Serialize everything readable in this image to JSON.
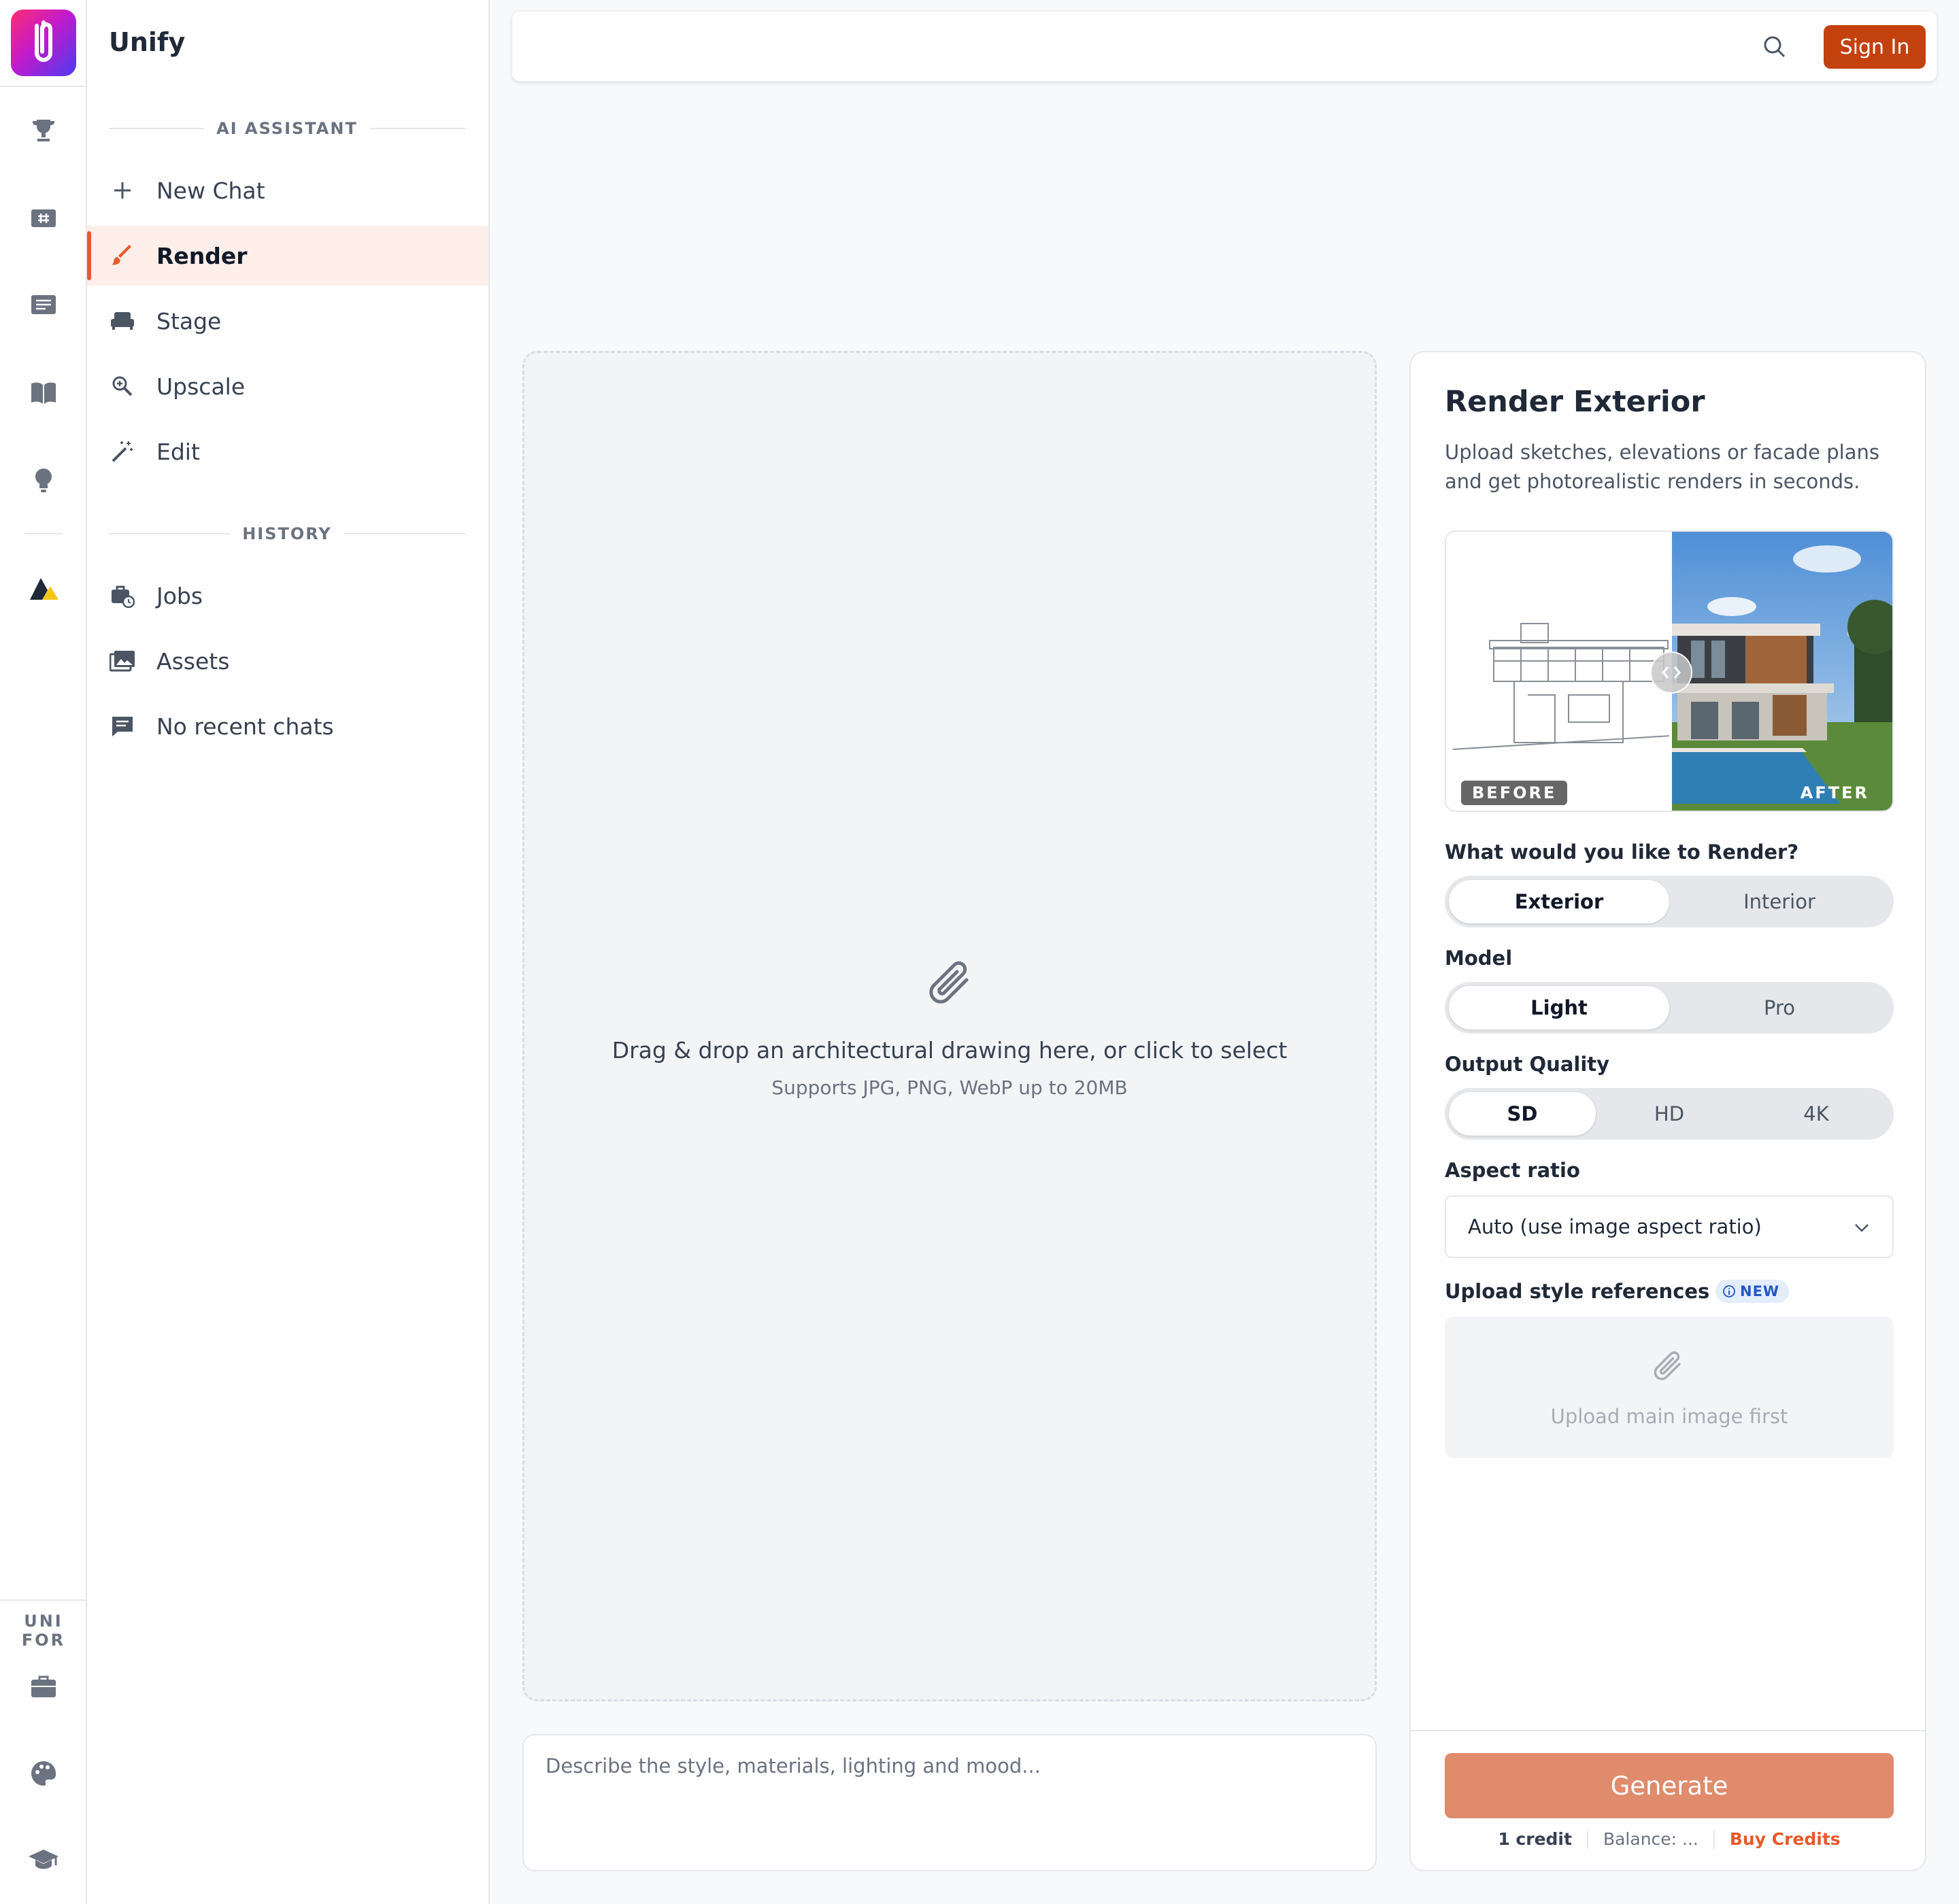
{
  "app": {
    "name": "Unify"
  },
  "rail": {
    "section_label": "UNI FOR"
  },
  "sidebar": {
    "ai_section": "AI ASSISTANT",
    "history_section": "HISTORY",
    "items": [
      {
        "label": "New Chat",
        "icon": "plus-icon"
      },
      {
        "label": "Render",
        "icon": "brush-icon",
        "active": true
      },
      {
        "label": "Stage",
        "icon": "sofa-icon"
      },
      {
        "label": "Upscale",
        "icon": "zoom-icon"
      },
      {
        "label": "Edit",
        "icon": "magic-wand-icon"
      }
    ],
    "history": [
      {
        "label": "Jobs",
        "icon": "briefcase-clock-icon"
      },
      {
        "label": "Assets",
        "icon": "images-icon"
      },
      {
        "label": "No recent chats",
        "icon": "chat-icon"
      }
    ]
  },
  "header": {
    "sign_in": "Sign In"
  },
  "upload": {
    "main_text": "Drag & drop an architectural drawing here, or click to select",
    "sub_text": "Supports JPG, PNG, WebP up to 20MB"
  },
  "prompt": {
    "placeholder": "Describe the style, materials, lighting and mood..."
  },
  "panel": {
    "title": "Render Exterior",
    "description": "Upload sketches, elevations or facade plans and get photorealistic renders in seconds.",
    "before_label": "BEFORE",
    "after_label": "AFTER",
    "render_question": "What would you like to Render?",
    "render_options": [
      "Exterior",
      "Interior"
    ],
    "render_selected": "Exterior",
    "model_label": "Model",
    "model_options": [
      "Light",
      "Pro"
    ],
    "model_selected": "Light",
    "quality_label": "Output Quality",
    "quality_options": [
      "SD",
      "HD",
      "4K"
    ],
    "quality_selected": "SD",
    "aspect_label": "Aspect ratio",
    "aspect_value": "Auto (use image aspect ratio)",
    "style_label": "Upload style references",
    "new_badge": "NEW",
    "style_placeholder": "Upload main image first",
    "generate": "Generate",
    "cost": "1 credit",
    "balance": "Balance: ...",
    "buy": "Buy Credits"
  },
  "colors": {
    "accent": "#e8592b",
    "signin": "#c2410c",
    "generate": "#e08b6b",
    "active_bg": "#fdeee9"
  }
}
